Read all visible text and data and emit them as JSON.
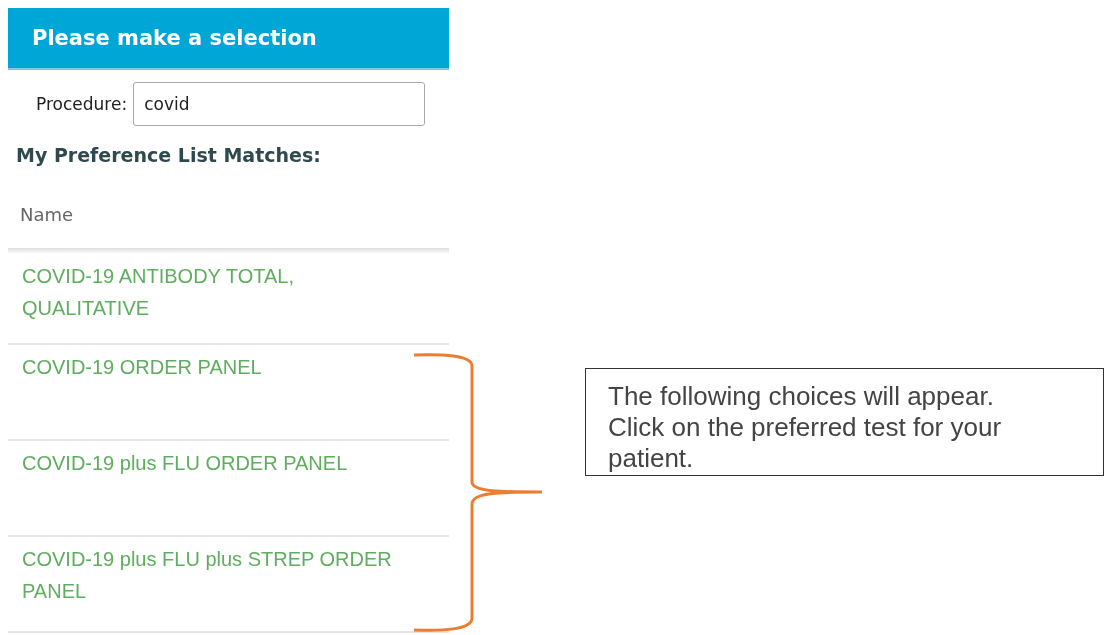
{
  "dialog": {
    "title": "Please make a selection",
    "procedure": {
      "label": "Procedure:",
      "value": "covid"
    },
    "section_title": "My Preference List Matches:",
    "column": "Name",
    "rows": [
      {
        "name": "COVID-19 ANTIBODY TOTAL, QUALITATIVE"
      },
      {
        "name": "COVID-19 ORDER PANEL"
      },
      {
        "name": "COVID-19 plus FLU ORDER PANEL"
      },
      {
        "name": "COVID-19 plus FLU plus STREP ORDER PANEL"
      }
    ]
  },
  "callout": {
    "text": "The following choices will appear. Click on the preferred test for your patient."
  }
}
